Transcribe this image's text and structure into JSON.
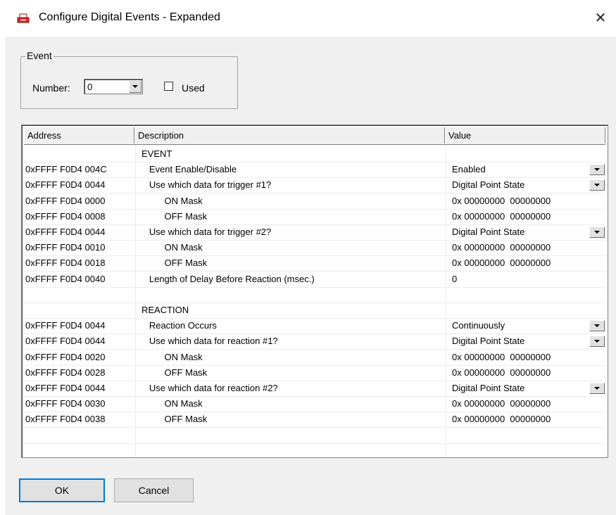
{
  "window": {
    "title": "Configure Digital Events - Expanded",
    "close_glyph": "✕"
  },
  "event_group": {
    "legend": "Event",
    "number_label": "Number:",
    "number_value": "0",
    "used_label": "Used",
    "used_checked": false
  },
  "grid": {
    "columns": [
      "Address",
      "Description",
      "Value"
    ],
    "rows": [
      {
        "addr": "",
        "desc": "EVENT",
        "value": "",
        "dropdown": false
      },
      {
        "addr": "0xFFFF F0D4 004C",
        "desc": "   Event Enable/Disable",
        "value": "Enabled",
        "dropdown": true
      },
      {
        "addr": "0xFFFF F0D4 0044",
        "desc": "   Use which data for trigger #1?",
        "value": "Digital Point State",
        "dropdown": true
      },
      {
        "addr": "0xFFFF F0D4 0000",
        "desc": "         ON Mask",
        "value": "0x 00000000  00000000",
        "dropdown": false
      },
      {
        "addr": "0xFFFF F0D4 0008",
        "desc": "         OFF Mask",
        "value": "0x 00000000  00000000",
        "dropdown": false
      },
      {
        "addr": "0xFFFF F0D4 0044",
        "desc": "   Use which data for trigger #2?",
        "value": "Digital Point State",
        "dropdown": true
      },
      {
        "addr": "0xFFFF F0D4 0010",
        "desc": "         ON Mask",
        "value": "0x 00000000  00000000",
        "dropdown": false
      },
      {
        "addr": "0xFFFF F0D4 0018",
        "desc": "         OFF Mask",
        "value": "0x 00000000  00000000",
        "dropdown": false
      },
      {
        "addr": "0xFFFF F0D4 0040",
        "desc": "   Length of Delay Before Reaction (msec.)",
        "value": "0",
        "dropdown": false
      },
      {
        "addr": "",
        "desc": "",
        "value": "",
        "dropdown": false
      },
      {
        "addr": "",
        "desc": "REACTION",
        "value": "",
        "dropdown": false
      },
      {
        "addr": "0xFFFF F0D4 0044",
        "desc": "   Reaction Occurs",
        "value": "Continuously",
        "dropdown": true
      },
      {
        "addr": "0xFFFF F0D4 0044",
        "desc": "   Use which data for reaction #1?",
        "value": "Digital Point State",
        "dropdown": true
      },
      {
        "addr": "0xFFFF F0D4 0020",
        "desc": "         ON Mask",
        "value": "0x 00000000  00000000",
        "dropdown": false
      },
      {
        "addr": "0xFFFF F0D4 0028",
        "desc": "         OFF Mask",
        "value": "0x 00000000  00000000",
        "dropdown": false
      },
      {
        "addr": "0xFFFF F0D4 0044",
        "desc": "   Use which data for reaction #2?",
        "value": "Digital Point State",
        "dropdown": true
      },
      {
        "addr": "0xFFFF F0D4 0030",
        "desc": "         ON Mask",
        "value": "0x 00000000  00000000",
        "dropdown": false
      },
      {
        "addr": "0xFFFF F0D4 0038",
        "desc": "         OFF Mask",
        "value": "0x 00000000  00000000",
        "dropdown": false
      },
      {
        "addr": "",
        "desc": "",
        "value": "",
        "dropdown": false
      },
      {
        "addr": "",
        "desc": "",
        "value": "",
        "dropdown": false
      }
    ]
  },
  "buttons": {
    "ok": "OK",
    "cancel": "Cancel"
  },
  "colors": {
    "accent": "#0078d7",
    "icon_red": "#d9252a"
  }
}
